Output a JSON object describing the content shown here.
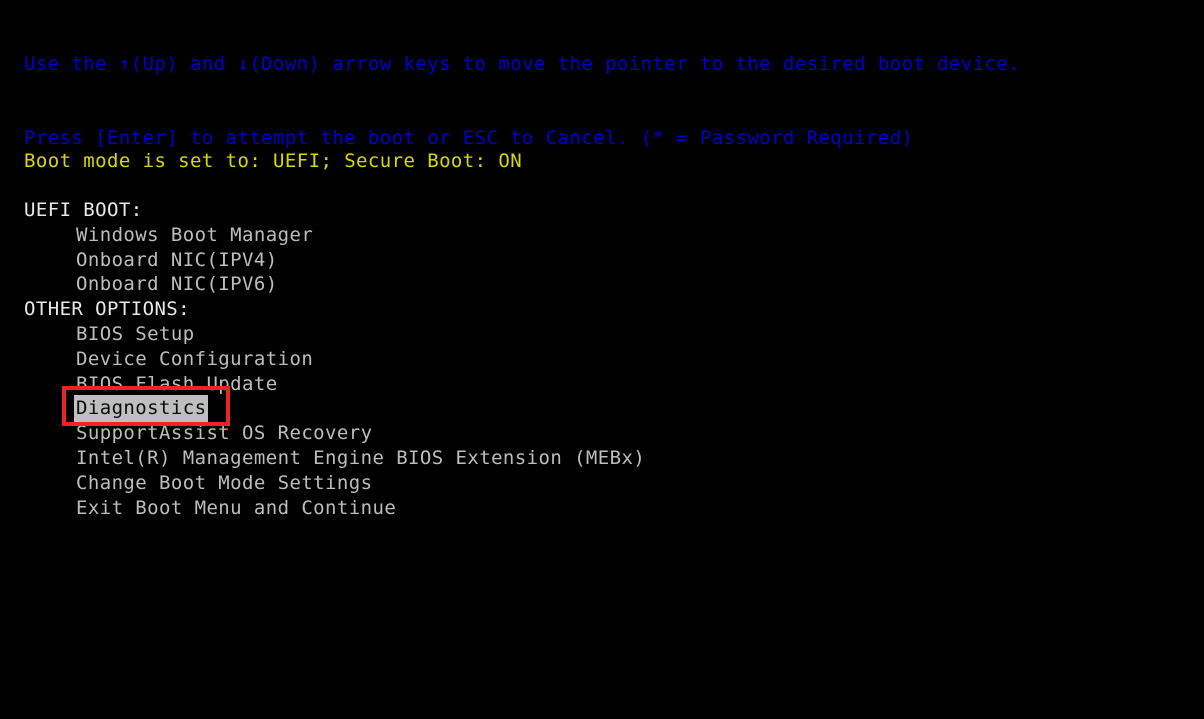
{
  "screen": {
    "background_color": "#000000",
    "instruction_color": "#0000cc",
    "bootmode_color": "#d8d800",
    "section_color": "#e9e9e9",
    "item_color": "#bdbdbd",
    "selection_bg_color": "#bfbfbf",
    "selection_fg_color": "#0b0b0b",
    "annotation_color": "#ee2424"
  },
  "instructions": {
    "line1": "Use the ↑(Up) and ↓(Down) arrow keys to move the pointer to the desired boot device.",
    "line2": "Press [Enter] to attempt the boot or ESC to Cancel. (* = Password Required)"
  },
  "status": {
    "boot_mode_line": "Boot mode is set to: UEFI; Secure Boot: ON"
  },
  "menu": {
    "sections": [
      {
        "header": "UEFI BOOT:",
        "items": [
          {
            "label": "Windows Boot Manager",
            "selected": false
          },
          {
            "label": "Onboard NIC(IPV4)",
            "selected": false
          },
          {
            "label": "Onboard NIC(IPV6)",
            "selected": false
          }
        ]
      },
      {
        "header": "OTHER OPTIONS:",
        "items": [
          {
            "label": "BIOS Setup",
            "selected": false
          },
          {
            "label": "Device Configuration",
            "selected": false
          },
          {
            "label": "BIOS Flash Update",
            "selected": false
          },
          {
            "label": "Diagnostics",
            "selected": true
          },
          {
            "label": "SupportAssist OS Recovery",
            "selected": false
          },
          {
            "label": "Intel(R) Management Engine BIOS Extension (MEBx)",
            "selected": false
          },
          {
            "label": "Change Boot Mode Settings",
            "selected": false
          },
          {
            "label": "Exit Boot Menu and Continue",
            "selected": false
          }
        ]
      }
    ]
  },
  "annotation": {
    "target_label": "Diagnostics"
  }
}
